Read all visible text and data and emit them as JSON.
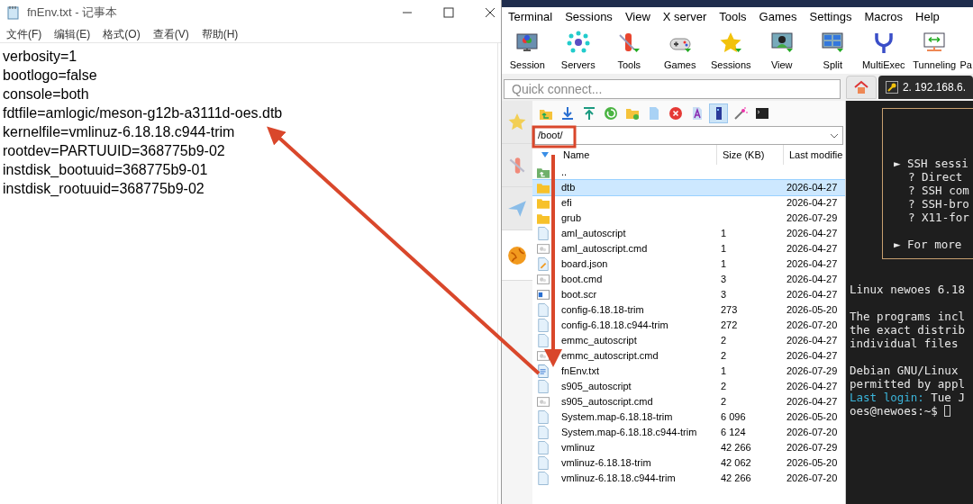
{
  "notepad": {
    "title": "fnEnv.txt - 记事本",
    "menu": [
      "文件(F)",
      "编辑(E)",
      "格式(O)",
      "查看(V)",
      "帮助(H)"
    ],
    "lines": [
      "verbosity=1",
      "bootlogo=false",
      "console=both",
      "fdtfile=amlogic/meson-g12b-a3111d-oes.dtb",
      "kernelfile=vmlinuz-6.18.18.c944-trim",
      "rootdev=PARTUUID=368775b9-02",
      "instdisk_bootuuid=368775b9-01",
      "instdisk_rootuuid=368775b9-02"
    ]
  },
  "mobaxterm": {
    "menu": [
      "Terminal",
      "Sessions",
      "View",
      "X server",
      "Tools",
      "Games",
      "Settings",
      "Macros",
      "Help"
    ],
    "toolbar": [
      {
        "kind": "session",
        "label": "Session"
      },
      {
        "kind": "servers",
        "label": "Servers"
      },
      {
        "kind": "tools",
        "label": "Tools"
      },
      {
        "kind": "games",
        "label": "Games"
      },
      {
        "kind": "sessions",
        "label": "Sessions"
      },
      {
        "kind": "view",
        "label": "View"
      },
      {
        "kind": "split",
        "label": "Split"
      },
      {
        "kind": "multiexec",
        "label": "MultiExec"
      },
      {
        "kind": "tunneling",
        "label": "Tunneling"
      },
      {
        "kind": "cut",
        "label": "Pa"
      }
    ],
    "quick_connect": {
      "placeholder": "Quick connect..."
    },
    "tabs": [
      {
        "kind": "home",
        "selected": false
      },
      {
        "kind": "session",
        "label": "2. 192.168.6.",
        "selected": true
      }
    ],
    "sidebar_tabs": [
      {
        "kind": "star",
        "selected": false
      },
      {
        "kind": "tools",
        "selected": false
      },
      {
        "kind": "send",
        "selected": false
      },
      {
        "kind": "globe",
        "selected": true
      }
    ],
    "file_toolbar": [
      {
        "kind": "up",
        "selected": false
      },
      {
        "kind": "download",
        "selected": false
      },
      {
        "kind": "upload",
        "selected": false
      },
      {
        "kind": "refresh",
        "selected": false
      },
      {
        "kind": "new-folder",
        "selected": false
      },
      {
        "kind": "new-file",
        "selected": false
      },
      {
        "kind": "delete",
        "selected": false
      },
      {
        "kind": "rename",
        "selected": false
      },
      {
        "kind": "column",
        "selected": true
      },
      {
        "kind": "wand",
        "selected": false
      },
      {
        "kind": "terminal",
        "selected": false
      }
    ],
    "file_browser": {
      "path": "/boot/",
      "columns": [
        "Name",
        "Size (KB)",
        "Last modifie"
      ],
      "rows": [
        {
          "kind": "parent",
          "name": "..",
          "selected": false
        },
        {
          "kind": "folder",
          "name": "dtb",
          "modified": "2026-04-27",
          "selected": true
        },
        {
          "kind": "folder",
          "name": "efi",
          "modified": "2026-04-27",
          "selected": false
        },
        {
          "kind": "folder",
          "name": "grub",
          "modified": "2026-07-29",
          "selected": false
        },
        {
          "kind": "file",
          "name": "aml_autoscript",
          "size": "1",
          "modified": "2026-04-27",
          "selected": false
        },
        {
          "kind": "script",
          "name": "aml_autoscript.cmd",
          "size": "1",
          "modified": "2026-04-27",
          "selected": false
        },
        {
          "kind": "json",
          "name": "board.json",
          "size": "1",
          "modified": "2026-04-27",
          "selected": false
        },
        {
          "kind": "script",
          "name": "boot.cmd",
          "size": "3",
          "modified": "2026-04-27",
          "selected": false
        },
        {
          "kind": "binary",
          "name": "boot.scr",
          "size": "3",
          "modified": "2026-04-27",
          "selected": false
        },
        {
          "kind": "file",
          "name": "config-6.18.18-trim",
          "size": "273",
          "modified": "2026-05-20",
          "selected": false
        },
        {
          "kind": "file",
          "name": "config-6.18.18.c944-trim",
          "size": "272",
          "modified": "2026-07-20",
          "selected": false
        },
        {
          "kind": "file",
          "name": "emmc_autoscript",
          "size": "2",
          "modified": "2026-04-27",
          "selected": false
        },
        {
          "kind": "script",
          "name": "emmc_autoscript.cmd",
          "size": "2",
          "modified": "2026-04-27",
          "selected": false
        },
        {
          "kind": "text",
          "name": "fnEnv.txt",
          "size": "1",
          "modified": "2026-07-29",
          "selected": false
        },
        {
          "kind": "file",
          "name": "s905_autoscript",
          "size": "2",
          "modified": "2026-04-27",
          "selected": false
        },
        {
          "kind": "script",
          "name": "s905_autoscript.cmd",
          "size": "2",
          "modified": "2026-04-27",
          "selected": false
        },
        {
          "kind": "file",
          "name": "System.map-6.18.18-trim",
          "size": "6 096",
          "modified": "2026-05-20",
          "selected": false
        },
        {
          "kind": "file",
          "name": "System.map-6.18.18.c944-trim",
          "size": "6 124",
          "modified": "2026-07-20",
          "selected": false
        },
        {
          "kind": "file",
          "name": "vmlinuz",
          "size": "42 266",
          "modified": "2026-07-29",
          "selected": false
        },
        {
          "kind": "file",
          "name": "vmlinuz-6.18.18-trim",
          "size": "42 062",
          "modified": "2026-05-20",
          "selected": false
        },
        {
          "kind": "file",
          "name": "vmlinuz-6.18.18.c944-trim",
          "size": "42 266",
          "modified": "2026-07-20",
          "selected": false
        }
      ]
    },
    "terminal": {
      "banner": [
        {
          "kind": "bullet",
          "text": "► SSH sessi"
        },
        {
          "kind": "sub",
          "text": "? Direct"
        },
        {
          "kind": "sub",
          "text": "? SSH com"
        },
        {
          "kind": "sub",
          "text": "? SSH-bro"
        },
        {
          "kind": "sub",
          "text": "? X11-for"
        },
        {
          "kind": "gap"
        },
        {
          "kind": "bullet",
          "text": "► For more"
        }
      ],
      "paragraphs": [
        [
          {
            "text": "Linux newoes 6.18"
          }
        ],
        [
          {
            "text": "The programs incl"
          },
          {
            "text": "the exact distrib"
          },
          {
            "text": "individual files"
          }
        ],
        [
          {
            "text": "Debian GNU/Linux"
          },
          {
            "text": "permitted by appl"
          },
          {
            "label": "Last login:",
            "text": " Tue J"
          },
          {
            "text": "oes@newoes:~$ ",
            "cursor": true
          }
        ]
      ]
    }
  }
}
